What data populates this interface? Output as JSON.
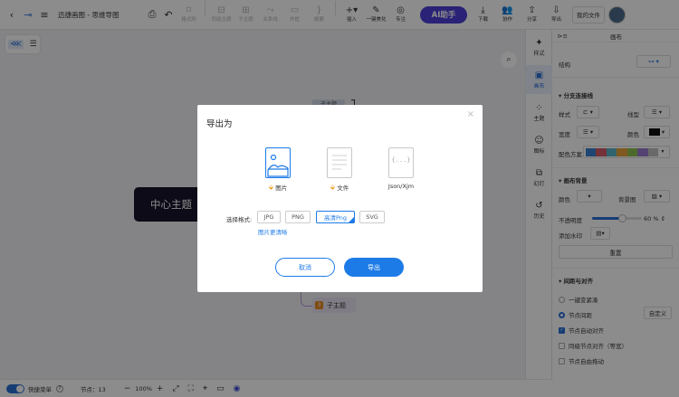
{
  "toolbar": {
    "doc_title": "迅捷画图 - 思维导图",
    "buttons": [
      {
        "name": "format-painter",
        "label": "格式刷",
        "glyph": "⌑",
        "disabled": true
      },
      {
        "name": "sibling-topic",
        "label": "同级主题",
        "glyph": "⊟",
        "disabled": true
      },
      {
        "name": "child-topic",
        "label": "子主题",
        "glyph": "⊞",
        "disabled": true
      },
      {
        "name": "relation",
        "label": "关系线",
        "glyph": "⤳",
        "disabled": true
      },
      {
        "name": "outline-frame",
        "label": "外框",
        "glyph": "▭",
        "disabled": true
      },
      {
        "name": "summary",
        "label": "概要",
        "glyph": "}",
        "disabled": true
      },
      {
        "name": "insert",
        "label": "插入",
        "glyph": "+▾",
        "disabled": false
      },
      {
        "name": "one-click-beautify",
        "label": "一键美化",
        "glyph": "✎",
        "disabled": false
      },
      {
        "name": "focus",
        "label": "专注",
        "glyph": "◎",
        "disabled": false
      }
    ],
    "ai_label": "AI助手",
    "right_buttons": [
      {
        "name": "download",
        "label": "下载",
        "glyph": "⤓"
      },
      {
        "name": "collaborate",
        "label": "协作",
        "glyph": "👥"
      },
      {
        "name": "share",
        "label": "分享",
        "glyph": "⇪"
      },
      {
        "name": "export",
        "label": "导出",
        "glyph": "⇩"
      }
    ],
    "my_files": "我的文件"
  },
  "canvas": {
    "center_topic": "中心主题",
    "sub_topic": "子主题",
    "sub_topic_num": "3",
    "top_topic": "子主题"
  },
  "modal": {
    "title": "导出为",
    "close": "×",
    "options": [
      {
        "label": "图片",
        "pinned": true
      },
      {
        "label": "文件",
        "pinned": true
      },
      {
        "label": "Json/Xjm",
        "pinned": false
      }
    ],
    "format_label": "选择格式:",
    "formats": [
      "JPG",
      "PNG",
      "高清Png",
      "SVG"
    ],
    "clarity_link": "图片更清晰",
    "cancel": "取消",
    "confirm": "导出"
  },
  "rail": [
    {
      "label": "样式",
      "glyph": "✦",
      "active": false
    },
    {
      "label": "画布",
      "glyph": "▣",
      "active": true
    },
    {
      "label": "主题",
      "glyph": "⁘",
      "active": false
    },
    {
      "label": "图标",
      "glyph": "☺",
      "active": false
    },
    {
      "label": "幻灯",
      "glyph": "⧉",
      "active": false
    },
    {
      "label": "历史",
      "glyph": "↺",
      "active": false
    }
  ],
  "panel": {
    "header_icon": "⊳≡",
    "title": "画布",
    "structure_label": "结构",
    "branch_section": "分支连接线",
    "style_label": "样式",
    "linetype_label": "线型",
    "width_label": "宽度",
    "color_label": "颜色",
    "scheme_label": "配色方案",
    "palette": [
      "#3a7fd0",
      "#d45a6a",
      "#59b7c9",
      "#e8a33a",
      "#8cc152",
      "#9a7bd0",
      "#c0c0c0"
    ],
    "bg_section": "画布背景",
    "bg_color_label": "颜色",
    "bg_image_label": "背景图",
    "opacity_label": "不透明度",
    "opacity_value": "60",
    "opacity_unit": "%",
    "opacity_fraction": 0.6,
    "watermark_label": "添加水印",
    "reset": "重置",
    "spacing_section": "间距与对齐",
    "options": [
      {
        "label": "一键变紧凑",
        "type": "radio",
        "on": false
      },
      {
        "label": "节点间距",
        "type": "radio",
        "on": true,
        "button": "自定义"
      },
      {
        "label": "节点自动对齐",
        "type": "check",
        "on": true
      },
      {
        "label": "同级节点对齐（等宽）",
        "type": "check",
        "on": false
      },
      {
        "label": "节点自由拖动",
        "type": "check",
        "on": false
      }
    ]
  },
  "statusbar": {
    "quick_menu": "快捷菜单",
    "help": "?",
    "nodes": "节点：13",
    "zoom": "100%"
  }
}
